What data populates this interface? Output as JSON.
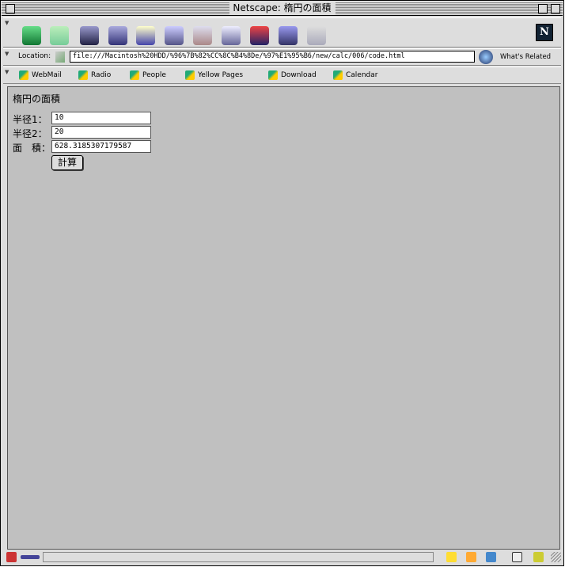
{
  "window": {
    "title": "Netscape: 楕円の面積"
  },
  "toolbar": {
    "icons": [
      "back-icon",
      "forward-icon",
      "reload-icon",
      "home-icon",
      "search-icon",
      "my-netscape-icon",
      "images-icon",
      "print-icon",
      "security-icon",
      "shop-icon",
      "stop-icon"
    ]
  },
  "location": {
    "label": "Location:",
    "url": "file:///Macintosh%20HDD/%96%7B%82%CC%8C%B4%8De/%97%E1%95%B6/new/calc/006/code.html",
    "related": "What's Related"
  },
  "personal": [
    "WebMail",
    "Radio",
    "People",
    "Yellow Pages",
    "Download",
    "Calendar"
  ],
  "page": {
    "heading": "楕円の面積",
    "r1_label": "半径1：",
    "r1_value": "10",
    "r2_label": "半径2：",
    "r2_value": "20",
    "area_label": "面　積：",
    "area_value": "628.3185307179587",
    "calc_button": "計算"
  }
}
